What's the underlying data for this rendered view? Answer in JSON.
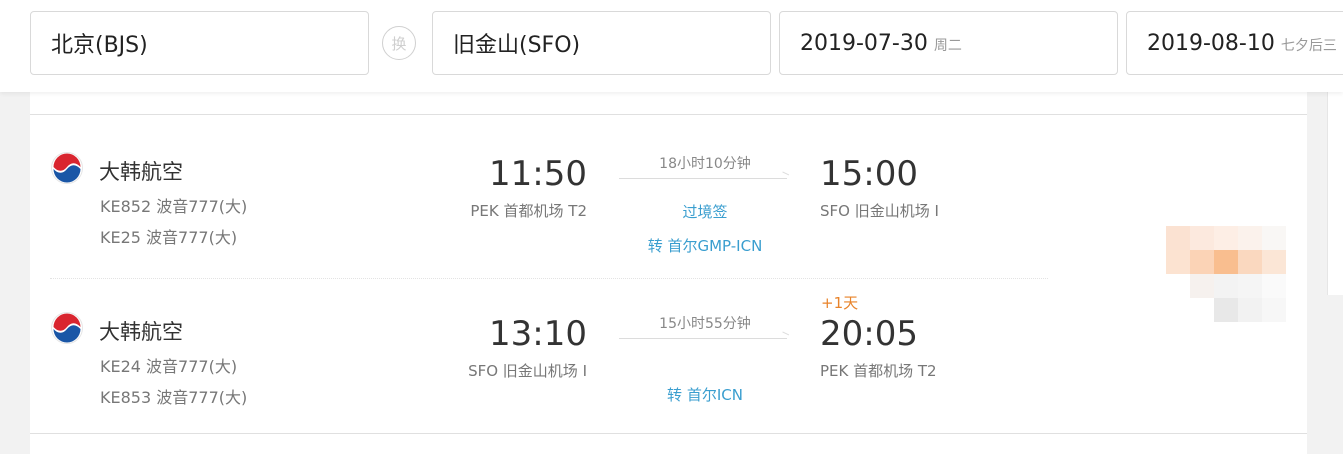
{
  "search": {
    "from_city": "北京(BJS)",
    "swap_label": "换",
    "to_city": "旧金山(SFO)",
    "depart_date": "2019-07-30",
    "depart_weekday": "周二",
    "return_date": "2019-08-10",
    "return_weekday": "七夕后三"
  },
  "flights": [
    {
      "airline": "大韩航空",
      "legs_info": [
        "KE852 波音777(大)",
        "KE25 波音777(大)"
      ],
      "dep_time": "11:50",
      "dep_airport": "PEK 首都机场 T2",
      "duration": "18小时10分钟",
      "arr_time": "15:00",
      "arr_airport": "SFO 旧金山机场 I",
      "day_offset": "",
      "notes": [
        "过境签",
        "转 首尔GMP-ICN"
      ]
    },
    {
      "airline": "大韩航空",
      "legs_info": [
        "KE24 波音777(大)",
        "KE853 波音777(大)"
      ],
      "dep_time": "13:10",
      "dep_airport": "SFO 旧金山机场 I",
      "duration": "15小时55分钟",
      "arr_time": "20:05",
      "arr_airport": "PEK 首都机场 T2",
      "day_offset": "+1天",
      "notes": [
        "",
        "转 首尔ICN"
      ]
    }
  ],
  "colors": {
    "link_blue": "#3a9ecf",
    "day_offset_orange": "#e8832a",
    "logo_red": "#d9252f",
    "logo_blue": "#1a56a6"
  },
  "icons": {
    "airline_logo": "korean-air-logo-icon",
    "swap": "swap-icon"
  }
}
